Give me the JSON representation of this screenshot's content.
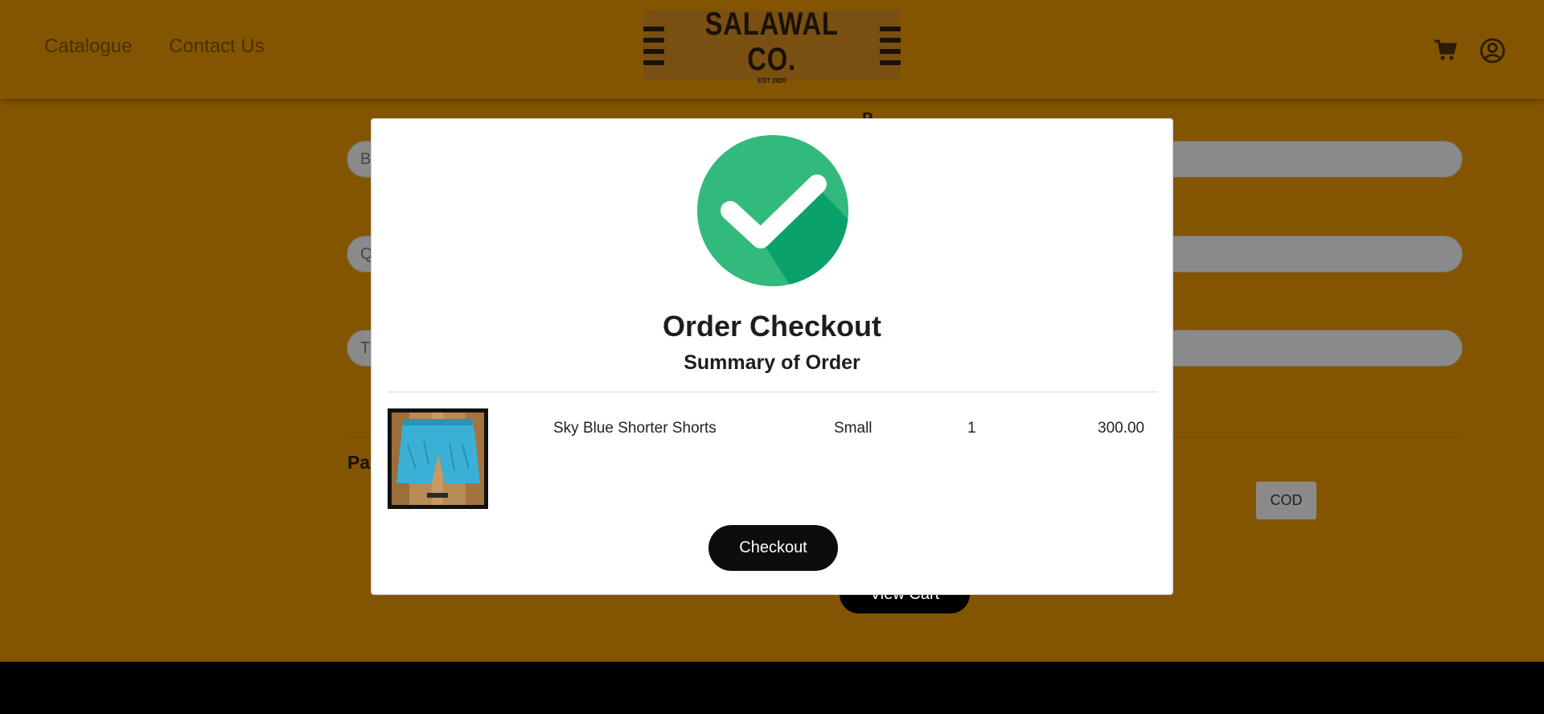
{
  "nav": {
    "catalogue": "Catalogue",
    "contact": "Contact Us"
  },
  "logo": {
    "name": "SALAWAL CO.",
    "est": "EST 2020"
  },
  "header_icons": [
    "cart-icon",
    "user-circle-icon"
  ],
  "background": {
    "field_initials": [
      "B",
      "Q",
      "T"
    ],
    "partial_label": "P",
    "payment_heading_partial": "Pay",
    "cod_label": "COD",
    "view_cart_label": "View Cart"
  },
  "modal": {
    "title": "Order Checkout",
    "subtitle": "Summary of Order",
    "items": [
      {
        "name": "Sky Blue Shorter Shorts",
        "size": "Small",
        "quantity": "1",
        "price": "300.00"
      }
    ],
    "checkout_label": "Checkout"
  },
  "colors": {
    "brand": "#845500",
    "success": "#32b97c",
    "button": "#0d0d0d"
  }
}
